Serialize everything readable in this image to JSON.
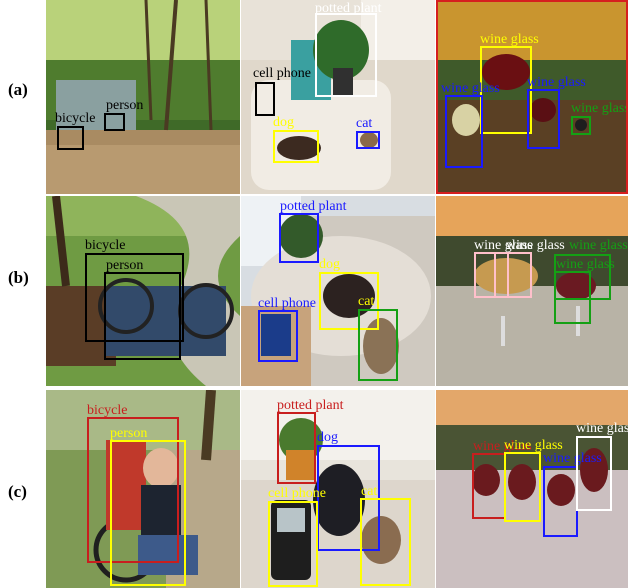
{
  "row_labels": [
    "(a)",
    "(b)",
    "(c)"
  ],
  "colors": {
    "black": "#000000",
    "white": "#ffffff",
    "blue": "#1a1aff",
    "yellow": "#ffff00",
    "green": "#14a014",
    "red": "#c81e1e",
    "pink": "#ffc0cb"
  },
  "panels": {
    "a1": {
      "labels": {
        "bicycle": "bicycle",
        "person": "person"
      }
    },
    "a2": {
      "labels": {
        "potted_plant": "potted plant",
        "cell_phone": "cell phone",
        "dog": "dog",
        "cat": "cat"
      }
    },
    "a3": {
      "labels": {
        "wg1": "wine glass",
        "wg2": "wine glass",
        "wg3": "wine glass",
        "wg4": "wine glass"
      }
    },
    "b1": {
      "labels": {
        "bicycle": "bicycle",
        "person": "person"
      }
    },
    "b2": {
      "labels": {
        "potted_plant": "potted plant",
        "dog": "dog",
        "cell_phone": "cell phone",
        "cat": "cat"
      }
    },
    "b3": {
      "labels": {
        "wg1": "wine glass",
        "wg2": "wine glass",
        "wg3": "wine glass",
        "wg4": "wine glass"
      }
    },
    "c1": {
      "labels": {
        "bicycle": "bicycle",
        "person": "person"
      }
    },
    "c2": {
      "labels": {
        "potted_plant": "potted plant",
        "dog": "dog",
        "cell_phone": "cell phone",
        "cat": "cat"
      }
    },
    "c3": {
      "labels": {
        "wg1": "wine glass",
        "wg2": "wine glass",
        "wg3": "wine glass",
        "wg4": "wine glass"
      }
    }
  }
}
